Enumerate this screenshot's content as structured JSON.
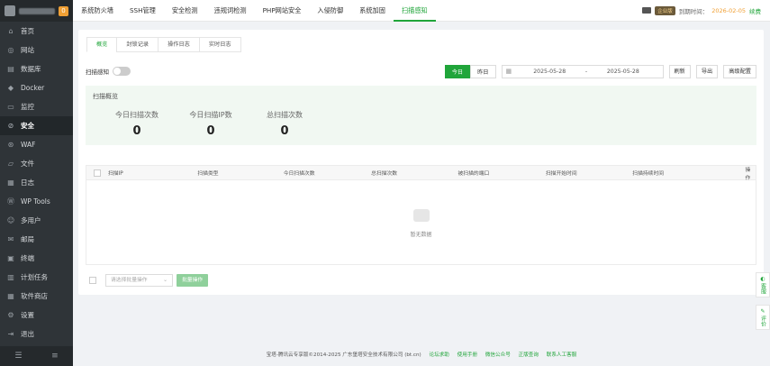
{
  "sidebar": {
    "badge": "0",
    "items": [
      {
        "label": "首页",
        "icon": "home-icon",
        "glyph": "⌂"
      },
      {
        "label": "网站",
        "icon": "globe-icon",
        "glyph": "◎"
      },
      {
        "label": "数据库",
        "icon": "database-icon",
        "glyph": "▤"
      },
      {
        "label": "Docker",
        "icon": "docker-icon",
        "glyph": "◆"
      },
      {
        "label": "监控",
        "icon": "monitor-icon",
        "glyph": "▭"
      },
      {
        "label": "安全",
        "icon": "shield-icon",
        "glyph": "⊘",
        "active": true
      },
      {
        "label": "WAF",
        "icon": "waf-icon",
        "glyph": "⊛"
      },
      {
        "label": "文件",
        "icon": "folder-icon",
        "glyph": "▱"
      },
      {
        "label": "日志",
        "icon": "log-icon",
        "glyph": "▦"
      },
      {
        "label": "WP Tools",
        "icon": "wordpress-icon",
        "glyph": "Ⓦ"
      },
      {
        "label": "多用户",
        "icon": "users-icon",
        "glyph": "☺"
      },
      {
        "label": "邮局",
        "icon": "mail-icon",
        "glyph": "✉"
      },
      {
        "label": "终端",
        "icon": "terminal-icon",
        "glyph": "▣"
      },
      {
        "label": "计划任务",
        "icon": "calendar-icon",
        "glyph": "▥"
      },
      {
        "label": "软件商店",
        "icon": "store-icon",
        "glyph": "▦"
      },
      {
        "label": "设置",
        "icon": "gear-icon",
        "glyph": "⚙"
      },
      {
        "label": "退出",
        "icon": "logout-icon",
        "glyph": "⇥"
      }
    ]
  },
  "topnav": {
    "items": [
      "系统防火墙",
      "SSH管理",
      "安全检测",
      "违规词检测",
      "PHP网站安全",
      "入侵防御",
      "系统加固",
      "扫描感知"
    ],
    "active_index": 7,
    "vip": "企业版",
    "expire_label": "到期时间：",
    "expire_date": "2026-02-05",
    "renew": "续费"
  },
  "tabs": [
    "概览",
    "封锁记录",
    "操作日志",
    "实时日志"
  ],
  "controls": {
    "toggle_label": "扫描感知",
    "today": "今日",
    "yesterday": "昨日",
    "date_start": "2025-05-28",
    "date_sep": "-",
    "date_end": "2025-05-28",
    "refresh": "刷新",
    "export": "导出",
    "advanced": "高级配置"
  },
  "overview": {
    "title": "扫描概览",
    "stats": [
      {
        "label": "今日扫描次数",
        "value": "0"
      },
      {
        "label": "今日扫描IP数",
        "value": "0"
      },
      {
        "label": "总扫描次数",
        "value": "0"
      }
    ]
  },
  "table": {
    "columns": [
      "扫描IP",
      "扫描类型",
      "今日扫描次数",
      "总扫描次数",
      "被扫描的端口",
      "扫描开始时间",
      "扫描持续时间",
      "操作"
    ],
    "empty_text": "暂无数据"
  },
  "batch": {
    "placeholder": "请选择批量操作",
    "button": "批量操作"
  },
  "footer": {
    "copyright": "宝塔-腾讯云专享版©2014-2025 广东堡塔安全技术有限公司 (bt.cn)",
    "links": [
      "论坛求助",
      "使用手册",
      "微信公众号",
      "正版查询",
      "联系人工客服"
    ]
  },
  "float": {
    "support": "客服",
    "review": "评价"
  },
  "colors": {
    "accent": "#20a53a",
    "sidebar_bg": "#2f3438",
    "warning": "#f0a035"
  }
}
